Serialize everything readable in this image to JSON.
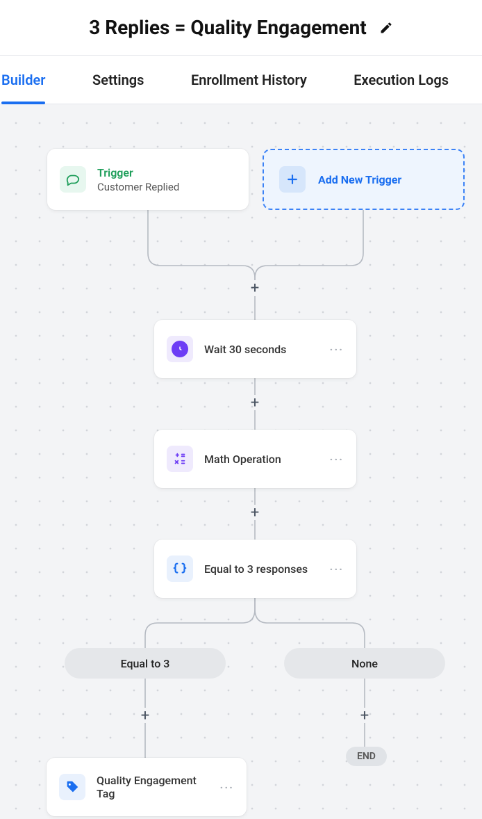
{
  "header": {
    "title": "3 Replies = Quality Engagement"
  },
  "tabs": [
    {
      "label": "Builder",
      "active": true
    },
    {
      "label": "Settings"
    },
    {
      "label": "Enrollment History"
    },
    {
      "label": "Execution Logs"
    }
  ],
  "nodes": {
    "trigger": {
      "title": "Trigger",
      "subtitle": "Customer Replied"
    },
    "add_trigger": {
      "label": "Add New Trigger"
    },
    "wait": {
      "label": "Wait 30 seconds"
    },
    "math": {
      "label": "Math Operation"
    },
    "condition": {
      "label": "Equal to 3 responses"
    },
    "branch_left": {
      "label": "Equal to 3"
    },
    "branch_right": {
      "label": "None"
    },
    "end": {
      "label": "END"
    },
    "tag": {
      "label": "Quality Engagement Tag"
    }
  }
}
